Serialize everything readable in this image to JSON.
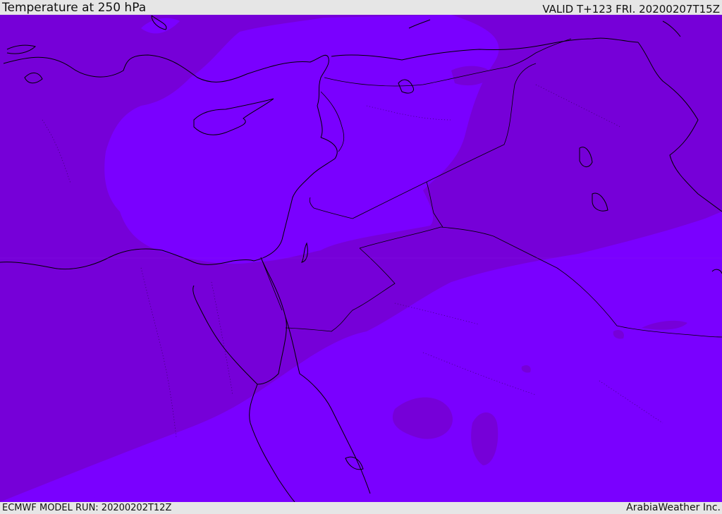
{
  "header": {
    "title": "Temperature at 250 hPa",
    "valid": "VALID T+123 FRI. 20200207T15Z"
  },
  "footer": {
    "model_run": "ECMWF MODEL RUN: 20200202T12Z",
    "credit": "ArabiaWeather Inc."
  },
  "colors": {
    "cold_band": "#7600d8",
    "warm_band": "#7a00ff",
    "coastline": "#000000",
    "bar_background": "#e6e6e6"
  }
}
